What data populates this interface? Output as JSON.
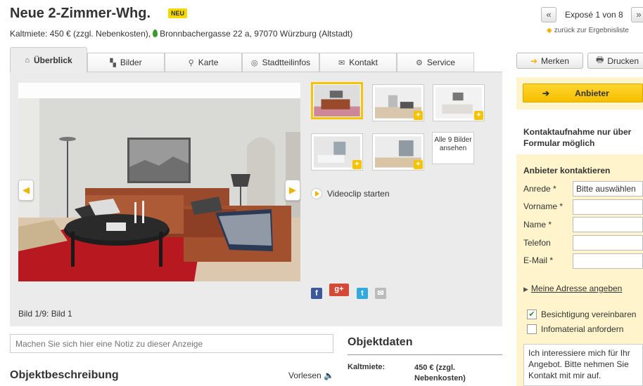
{
  "header": {
    "title": "Neue 2-Zimmer-Whg.",
    "badge": "NEU",
    "subline": "Kaltmiete: 450 € (zzgl. Nebenkosten),",
    "address": "Bronnbachergasse 22 a, 97070 Würzburg (Altstadt)"
  },
  "pager": {
    "prev": "«",
    "count": "Exposé 1 von 8",
    "next": "»",
    "back": "zurück zur Ergebnisliste"
  },
  "tabs": [
    {
      "label": "Überblick",
      "icon": "home-icon"
    },
    {
      "label": "Bilder",
      "icon": "images-icon"
    },
    {
      "label": "Karte",
      "icon": "map-pin-icon"
    },
    {
      "label": "Stadtteilinfos",
      "icon": "target-icon"
    },
    {
      "label": "Kontakt",
      "icon": "envelope-icon"
    },
    {
      "label": "Service",
      "icon": "gears-icon"
    }
  ],
  "actions": {
    "merken": "Merken",
    "drucken": "Drucken"
  },
  "gallery": {
    "caption": "Bild 1/9: Bild 1",
    "all_button": "Alle 9 Bilder ansehen",
    "video": "Videoclip starten"
  },
  "note_placeholder": "Machen Sie sich hier eine Notiz zu dieser Anzeige",
  "description": {
    "heading": "Objektbeschreibung",
    "read_aloud": "Vorlesen"
  },
  "objektdaten": {
    "heading": "Objektdaten",
    "label": "Kaltmiete:",
    "value": "450 € (zzgl. Nebenkosten)"
  },
  "contact": {
    "anbieter_button": "Anbieter",
    "note": "Kontaktaufnahme nur über Formular möglich",
    "heading": "Anbieter kontaktieren",
    "fields": {
      "anrede_label": "Anrede *",
      "anrede_value": "Bitte auswählen",
      "vorname_label": "Vorname *",
      "name_label": "Name *",
      "telefon_label": "Telefon",
      "email_label": "E-Mail *"
    },
    "address_link": "Meine Adresse angeben",
    "checkbox1": "Besichtigung vereinbaren",
    "checkbox1_checked": true,
    "checkbox2": "Infomaterial anfordern",
    "checkbox2_checked": false,
    "message": "Ich interessiere mich für Ihr Angebot. Bitte nehmen Sie Kontakt mit mir auf."
  },
  "colors": {
    "accent": "#f5c300",
    "panel": "#fff4cc"
  }
}
